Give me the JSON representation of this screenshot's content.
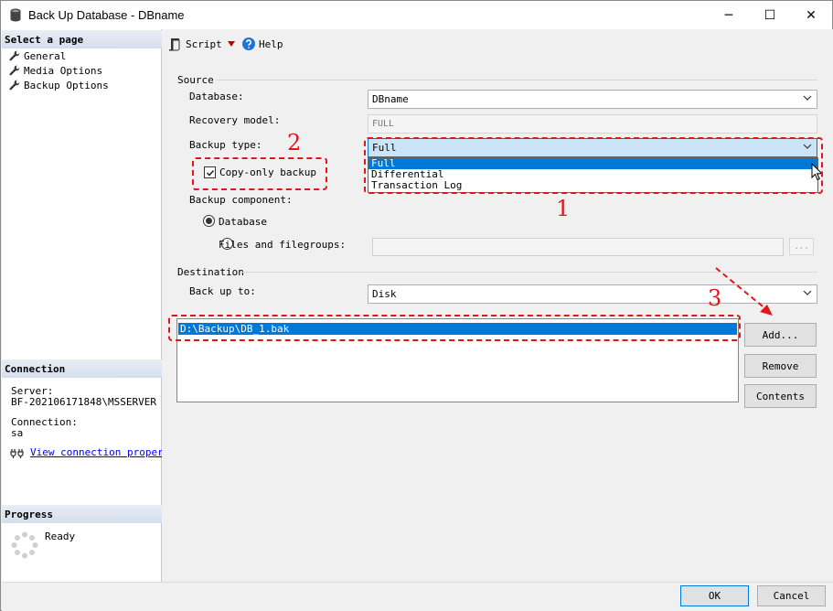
{
  "window": {
    "title": "Back Up Database - DBname",
    "minimize_glyph": "─",
    "maximize_glyph": "☐",
    "close_glyph": "✕"
  },
  "sidebar": {
    "select_page_header": "Select a page",
    "pages": [
      {
        "label": "General",
        "icon": "wrench-icon"
      },
      {
        "label": "Media Options",
        "icon": "wrench-icon"
      },
      {
        "label": "Backup Options",
        "icon": "wrench-icon"
      }
    ],
    "connection_header": "Connection",
    "server_label": "Server:",
    "server_value": "BF-202106171848\\MSSERVER",
    "connection_label": "Connection:",
    "connection_value": "sa",
    "view_connection_link": "View connection properti",
    "progress_header": "Progress",
    "progress_status": "Ready"
  },
  "toolbar": {
    "script_label": "Script",
    "help_label": "Help"
  },
  "source": {
    "group_title": "Source",
    "database_label": "Database:",
    "database_value": "DBname",
    "recovery_model_label": "Recovery model:",
    "recovery_model_value": "FULL",
    "backup_type_label": "Backup type:",
    "backup_type_value": "Full",
    "backup_type_options": [
      "Full",
      "Differential",
      "Transaction Log"
    ],
    "copy_only_label": "Copy-only backup",
    "backup_component_label": "Backup component:",
    "component_database_label": "Database",
    "component_files_label": "Files and filegroups:",
    "browse_glyph": "..."
  },
  "destination": {
    "group_title": "Destination",
    "back_up_to_label": "Back up to:",
    "back_up_to_value": "Disk",
    "paths": [
      "D:\\Backup\\DB_1.bak"
    ],
    "add_button": "Add...",
    "remove_button": "Remove",
    "contents_button": "Contents"
  },
  "footer": {
    "ok_button": "OK",
    "cancel_button": "Cancel"
  },
  "annotations": {
    "one": "1",
    "two": "2",
    "three": "3"
  },
  "colors": {
    "accent": "#0078d7",
    "annotation": "#e0161b",
    "link": "#0000ee"
  }
}
